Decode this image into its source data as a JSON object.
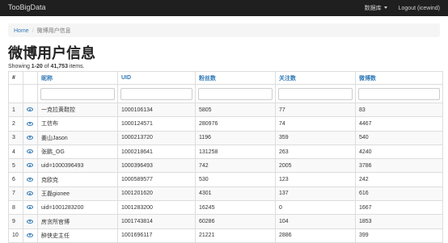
{
  "navbar": {
    "brand": "TooBigData",
    "database_menu": "数据库",
    "logout": "Logout (icewind)"
  },
  "breadcrumb": {
    "home": "Home",
    "separator": "/",
    "current": "微博用户信息"
  },
  "page_title": "微博用户信息",
  "summary": {
    "prefix": "Showing ",
    "range": "1-20",
    "middle": " of ",
    "total": "41,753",
    "suffix": " items."
  },
  "table": {
    "headers": [
      "#",
      "",
      "昵称",
      "UID",
      "粉丝数",
      "关注数",
      "微博数"
    ],
    "rows": [
      {
        "index": "1",
        "nickname": "一克拉黄鞋控",
        "uid": "1000106134",
        "fans": "5805",
        "follows": "77",
        "weibos": "83"
      },
      {
        "index": "2",
        "nickname": "工信布",
        "uid": "1000124571",
        "fans": "280976",
        "follows": "74",
        "weibos": "4467"
      },
      {
        "index": "3",
        "nickname": "姜山Jason",
        "uid": "1000213720",
        "fans": "1196",
        "follows": "359",
        "weibos": "540"
      },
      {
        "index": "4",
        "nickname": "张鹏_OG",
        "uid": "1000218641",
        "fans": "131258",
        "follows": "263",
        "weibos": "4240"
      },
      {
        "index": "5",
        "nickname": "uid=1000396493",
        "uid": "1000396493",
        "fans": "742",
        "follows": "2005",
        "weibos": "3786"
      },
      {
        "index": "6",
        "nickname": "克欧克",
        "uid": "1000589577",
        "fans": "530",
        "follows": "123",
        "weibos": "242"
      },
      {
        "index": "7",
        "nickname": "王磊gionee",
        "uid": "1001201620",
        "fans": "4301",
        "follows": "137",
        "weibos": "616"
      },
      {
        "index": "8",
        "nickname": "uid=1001283200",
        "uid": "1001283200",
        "fans": "16245",
        "follows": "0",
        "weibos": "1667"
      },
      {
        "index": "9",
        "nickname": "房贪所官博",
        "uid": "1001743814",
        "fans": "60286",
        "follows": "104",
        "weibos": "1853"
      },
      {
        "index": "10",
        "nickname": "醉侠史主任",
        "uid": "1001696117",
        "fans": "21221",
        "follows": "2886",
        "weibos": "399"
      }
    ]
  }
}
